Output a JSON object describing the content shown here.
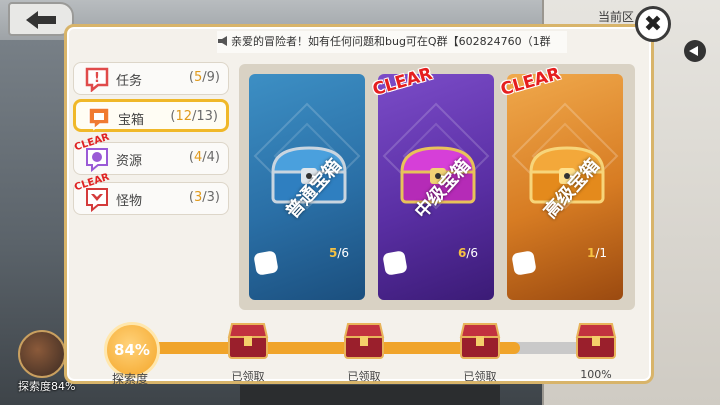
{
  "background": {
    "region_label": "当前区",
    "explore_label": "探索度84%"
  },
  "notice": {
    "text": "亲爱的冒险者！如有任何问题和bug可在Q群【602824760（1群"
  },
  "close_label": "✖",
  "tabs": [
    {
      "label": "任务",
      "count": "5",
      "total": "9",
      "active": false,
      "clear": false,
      "color": "#e04a4a"
    },
    {
      "label": "宝箱",
      "count": "12",
      "total": "13",
      "active": true,
      "clear": false,
      "color": "#f07a32"
    },
    {
      "label": "资源",
      "count": "4",
      "total": "4",
      "active": false,
      "clear": true,
      "color": "#9a5ad6"
    },
    {
      "label": "怪物",
      "count": "3",
      "total": "3",
      "active": false,
      "clear": true,
      "color": "#d43a3a"
    }
  ],
  "clear_text": "CLEAR",
  "cards": [
    {
      "label": "普通宝箱",
      "count": "5",
      "total": "6",
      "clear": false,
      "color": "#3d8fc4"
    },
    {
      "label": "中级宝箱",
      "count": "6",
      "total": "6",
      "clear": true,
      "color": "#7b4cc8"
    },
    {
      "label": "高级宝箱",
      "count": "1",
      "total": "1",
      "clear": true,
      "color": "#f0a94c"
    }
  ],
  "progress": {
    "percent": 84,
    "percent_text": "84%",
    "label": "探索度",
    "milestones": [
      {
        "label": "已领取"
      },
      {
        "label": "已领取"
      },
      {
        "label": "已领取"
      },
      {
        "label": "100%"
      }
    ]
  }
}
